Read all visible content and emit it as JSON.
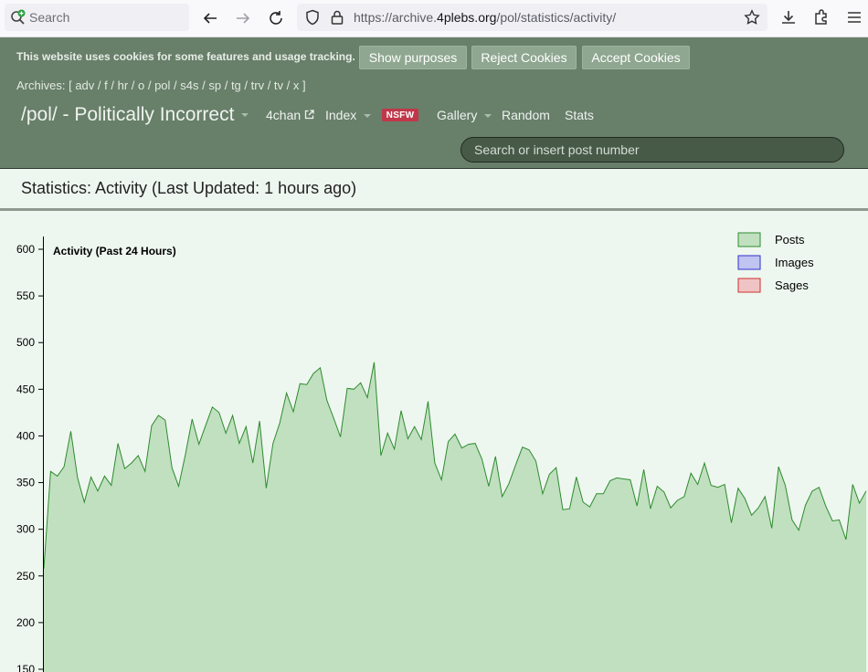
{
  "browser": {
    "search_placeholder": "Search",
    "url_prefix": "https://archive.",
    "url_domain": "4plebs.org",
    "url_path": "/pol/statistics/activity/"
  },
  "cookies": {
    "message": "This website uses cookies for some features and usage tracking.",
    "show_purposes": "Show purposes",
    "reject": "Reject Cookies",
    "accept": "Accept Cookies"
  },
  "archives": {
    "prefix": "Archives: [",
    "boards": [
      "adv",
      "f",
      "hr",
      "o",
      "pol",
      "s4s",
      "sp",
      "tg",
      "trv",
      "tv",
      "x"
    ],
    "suffix": "]"
  },
  "board_nav": {
    "title": "/pol/ - Politically Incorrect",
    "fourchan": "4chan",
    "index": "Index",
    "nsfw": "NSFW",
    "gallery": "Gallery",
    "random": "Random",
    "stats": "Stats"
  },
  "post_search": {
    "placeholder": "Search or insert post number"
  },
  "page": {
    "title": "Statistics: Activity (Last Updated: 1 hours ago)"
  },
  "chart_data": {
    "type": "area",
    "title": "Activity (Past 24 Hours)",
    "y_ticks": [
      150,
      200,
      250,
      300,
      350,
      400,
      450,
      500,
      550,
      600
    ],
    "ylim": [
      150,
      610
    ],
    "legend_position": "top-right",
    "series": [
      {
        "name": "Posts",
        "color": "#2e8b2e",
        "fill": "#c0e0c0",
        "values": [
          258,
          362,
          357,
          367,
          405,
          355,
          329,
          356,
          341,
          357,
          347,
          392,
          365,
          371,
          379,
          362,
          411,
          422,
          417,
          366,
          346,
          380,
          418,
          391,
          411,
          431,
          425,
          403,
          422,
          392,
          410,
          371,
          416,
          344,
          392,
          414,
          446,
          426,
          456,
          455,
          467,
          473,
          438,
          419,
          399,
          451,
          450,
          457,
          441,
          479,
          379,
          403,
          386,
          427,
          397,
          410,
          396,
          437,
          371,
          353,
          394,
          402,
          387,
          391,
          392,
          375,
          346,
          378,
          335,
          349,
          369,
          388,
          385,
          373,
          338,
          359,
          366,
          321,
          322,
          356,
          329,
          324,
          338,
          338,
          352,
          355,
          354,
          353,
          325,
          364,
          322,
          346,
          340,
          323,
          331,
          335,
          360,
          348,
          371,
          347,
          345,
          348,
          307,
          344,
          333,
          315,
          323,
          335,
          301,
          367,
          347,
          310,
          299,
          326,
          341,
          345,
          325,
          309,
          310,
          289,
          348,
          328,
          341
        ]
      },
      {
        "name": "Images",
        "color": "#3030d0",
        "fill": "#c0c4f0",
        "values": []
      },
      {
        "name": "Sages",
        "color": "#d03030",
        "fill": "#f0c4c4",
        "values": []
      }
    ]
  }
}
